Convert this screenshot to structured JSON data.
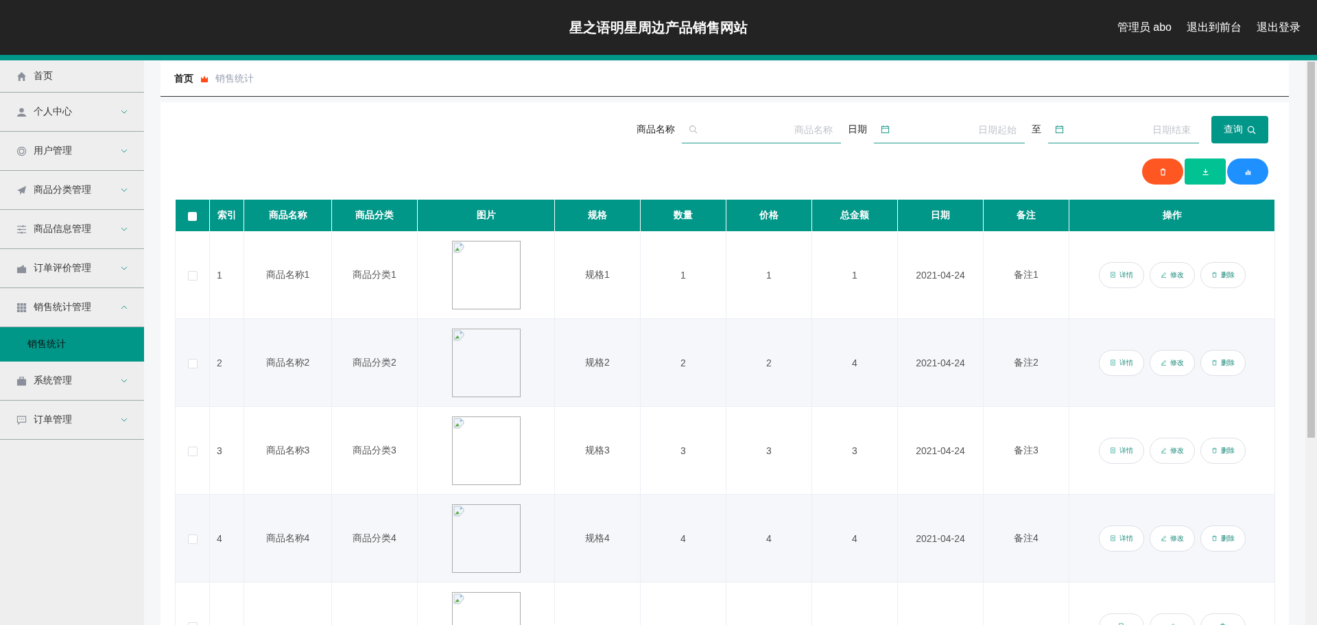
{
  "header": {
    "title": "星之语明星周边产品销售网站",
    "links": [
      "管理员 abo",
      "退出到前台",
      "退出登录"
    ]
  },
  "sidebar": {
    "items": [
      {
        "label": "首页"
      },
      {
        "label": "个人中心",
        "expanded": false
      },
      {
        "label": "用户管理",
        "expanded": false
      },
      {
        "label": "商品分类管理",
        "expanded": false
      },
      {
        "label": "商品信息管理",
        "expanded": false
      },
      {
        "label": "订单评价管理",
        "expanded": false
      },
      {
        "label": "销售统计管理",
        "expanded": true,
        "children": [
          {
            "label": "销售统计",
            "selected": true
          }
        ]
      },
      {
        "label": "系统管理",
        "expanded": false
      },
      {
        "label": "订单管理",
        "expanded": false
      }
    ]
  },
  "breadcrumb": [
    "首页",
    "销售统计"
  ],
  "search": {
    "fields": [
      {
        "label": "商品名称",
        "placeholder": "商品名称",
        "kind": "search"
      },
      {
        "label": "日期",
        "placeholder": "日期起始",
        "kind": "date"
      },
      {
        "label": "至",
        "placeholder": "日期结束",
        "kind": "date"
      }
    ],
    "button": "查询"
  },
  "actions": [
    {
      "kind": "delete",
      "color": "#ff5722"
    },
    {
      "kind": "download",
      "color": "#00c292"
    },
    {
      "kind": "chart",
      "color": "#1e90ff"
    }
  ],
  "table": {
    "select_all_checked": false,
    "columns": [
      "索引",
      "商品名称",
      "商品分类",
      "图片",
      "规格",
      "数量",
      "价格",
      "总金额",
      "日期",
      "备注",
      "操作"
    ],
    "rows": [
      {
        "checked": false,
        "cells": [
          "1",
          "商品名称1",
          "商品分类1",
          "",
          "规格1",
          "1",
          "1",
          "1",
          "2021-04-24",
          "备注1"
        ],
        "actions": [
          {
            "kind": "detail",
            "label": "详情"
          },
          {
            "kind": "edit",
            "label": "修改"
          },
          {
            "kind": "delete",
            "label": "删除"
          }
        ]
      },
      {
        "checked": false,
        "cells": [
          "2",
          "商品名称2",
          "商品分类2",
          "",
          "规格2",
          "2",
          "2",
          "4",
          "2021-04-24",
          "备注2"
        ],
        "actions": [
          {
            "kind": "detail",
            "label": "详情"
          },
          {
            "kind": "edit",
            "label": "修改"
          },
          {
            "kind": "delete",
            "label": "删除"
          }
        ]
      },
      {
        "checked": false,
        "cells": [
          "3",
          "商品名称3",
          "商品分类3",
          "",
          "规格3",
          "3",
          "3",
          "3",
          "2021-04-24",
          "备注3"
        ],
        "actions": [
          {
            "kind": "detail",
            "label": "详情"
          },
          {
            "kind": "edit",
            "label": "修改"
          },
          {
            "kind": "delete",
            "label": "删除"
          }
        ]
      },
      {
        "checked": false,
        "cells": [
          "4",
          "商品名称4",
          "商品分类4",
          "",
          "规格4",
          "4",
          "4",
          "4",
          "2021-04-24",
          "备注4"
        ],
        "actions": [
          {
            "kind": "detail",
            "label": "详情"
          },
          {
            "kind": "edit",
            "label": "修改"
          },
          {
            "kind": "delete",
            "label": "删除"
          }
        ]
      },
      {
        "checked": false,
        "actions": [
          {
            "kind": "detail"
          },
          {
            "kind": "edit"
          },
          {
            "kind": "delete"
          }
        ]
      }
    ]
  }
}
